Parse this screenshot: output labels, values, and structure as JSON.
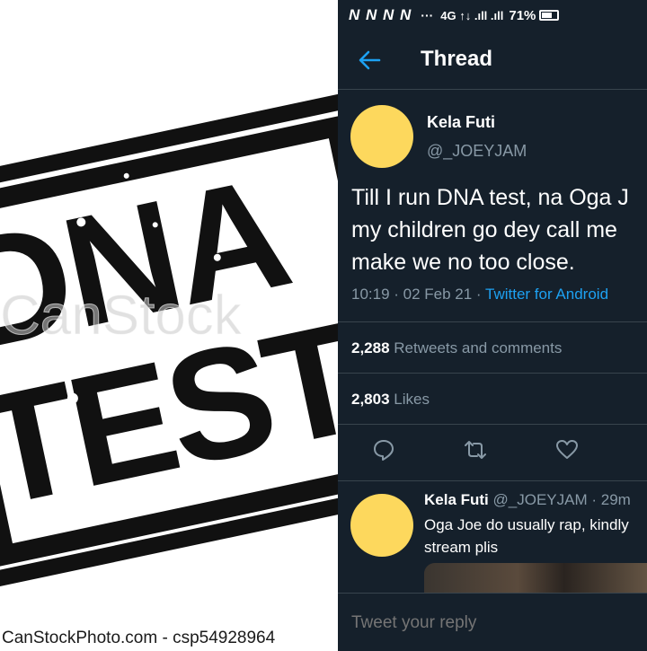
{
  "stock_image": {
    "word_top": "DNA",
    "word_bottom": "TEST",
    "watermark": "CanStock",
    "credit": "CanStockPhoto.com - csp54928964"
  },
  "status_bar": {
    "carrier_icons": "N N N N",
    "dots": "···",
    "network_icons": "4G ↑↓ .ıll .ıll",
    "battery": "71%",
    "battery_level": 0.71
  },
  "header": {
    "title": "Thread",
    "back_icon": "back-arrow-icon"
  },
  "main_tweet": {
    "author_name": "Kela Futi",
    "author_handle": "@_JOEYJAM",
    "text_lines": [
      "Till I run DNA test, na Oga J",
      "my children go dey call me",
      "make we no too close."
    ],
    "time": "10:19 · 02 Feb 21 · ",
    "source": "Twitter for Android",
    "retweets_count": "2,288",
    "retweets_label": "Retweets and comments",
    "likes_count": "2,803",
    "likes_label": "Likes",
    "actions": [
      "reply-icon",
      "retweet-icon",
      "like-icon"
    ]
  },
  "reply": {
    "author_name": "Kela Futi",
    "handle_time": " @_JOEYJAM · 29m",
    "text": "Oga Joe do usually rap, kindly stream plis"
  },
  "compose": {
    "placeholder": "Tweet your reply"
  },
  "colors": {
    "background": "#15202b",
    "accent": "#1da1f2",
    "muted": "#8899a6",
    "avatar": "#fdd85d"
  }
}
